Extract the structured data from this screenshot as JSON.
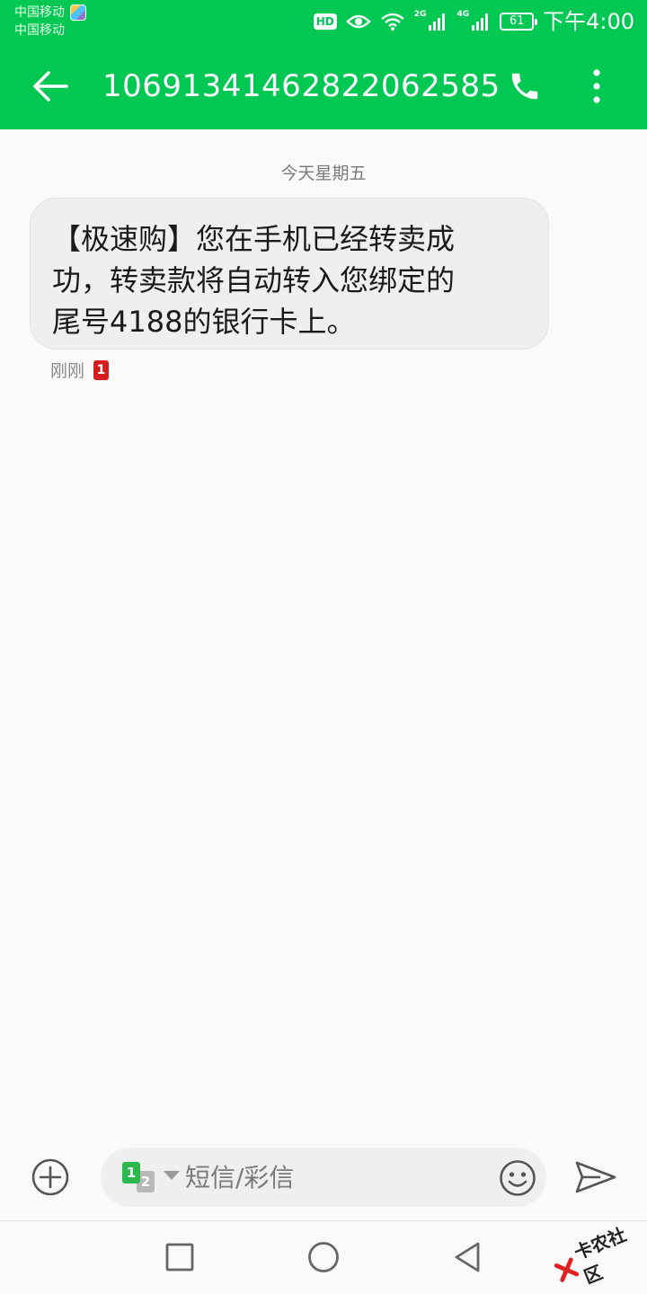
{
  "status_bar": {
    "carrier_1": "中国移动",
    "carrier_2": "中国移动",
    "hd": "HD",
    "signal_1_tag": "2G",
    "signal_2_tag": "4G",
    "battery": "61",
    "time": "下午4:00"
  },
  "app_bar": {
    "title": "10691341462822062585",
    "back_icon": "back-arrow-icon",
    "call_icon": "phone-icon",
    "more_icon": "more-vertical-icon",
    "color": "#00c853"
  },
  "conversation": {
    "date_separator": "今天星期五",
    "messages": [
      {
        "lines": [
          "【极速购】您在手机已经转卖成",
          "功，转卖款将自动转入您绑定的",
          "尾号4188的银行卡上。"
        ],
        "time": "刚刚",
        "sim": "1"
      }
    ]
  },
  "composer": {
    "attach_icon": "add-circle-icon",
    "sim_primary": "1",
    "sim_secondary": "2",
    "placeholder": "短信/彩信",
    "emoji_icon": "emoji-icon",
    "send_icon": "send-icon"
  },
  "nav_bar": {
    "recent_icon": "square-icon",
    "home_icon": "circle-icon",
    "back_icon": "triangle-back-icon"
  },
  "watermark": {
    "text": "卡农社区"
  }
}
